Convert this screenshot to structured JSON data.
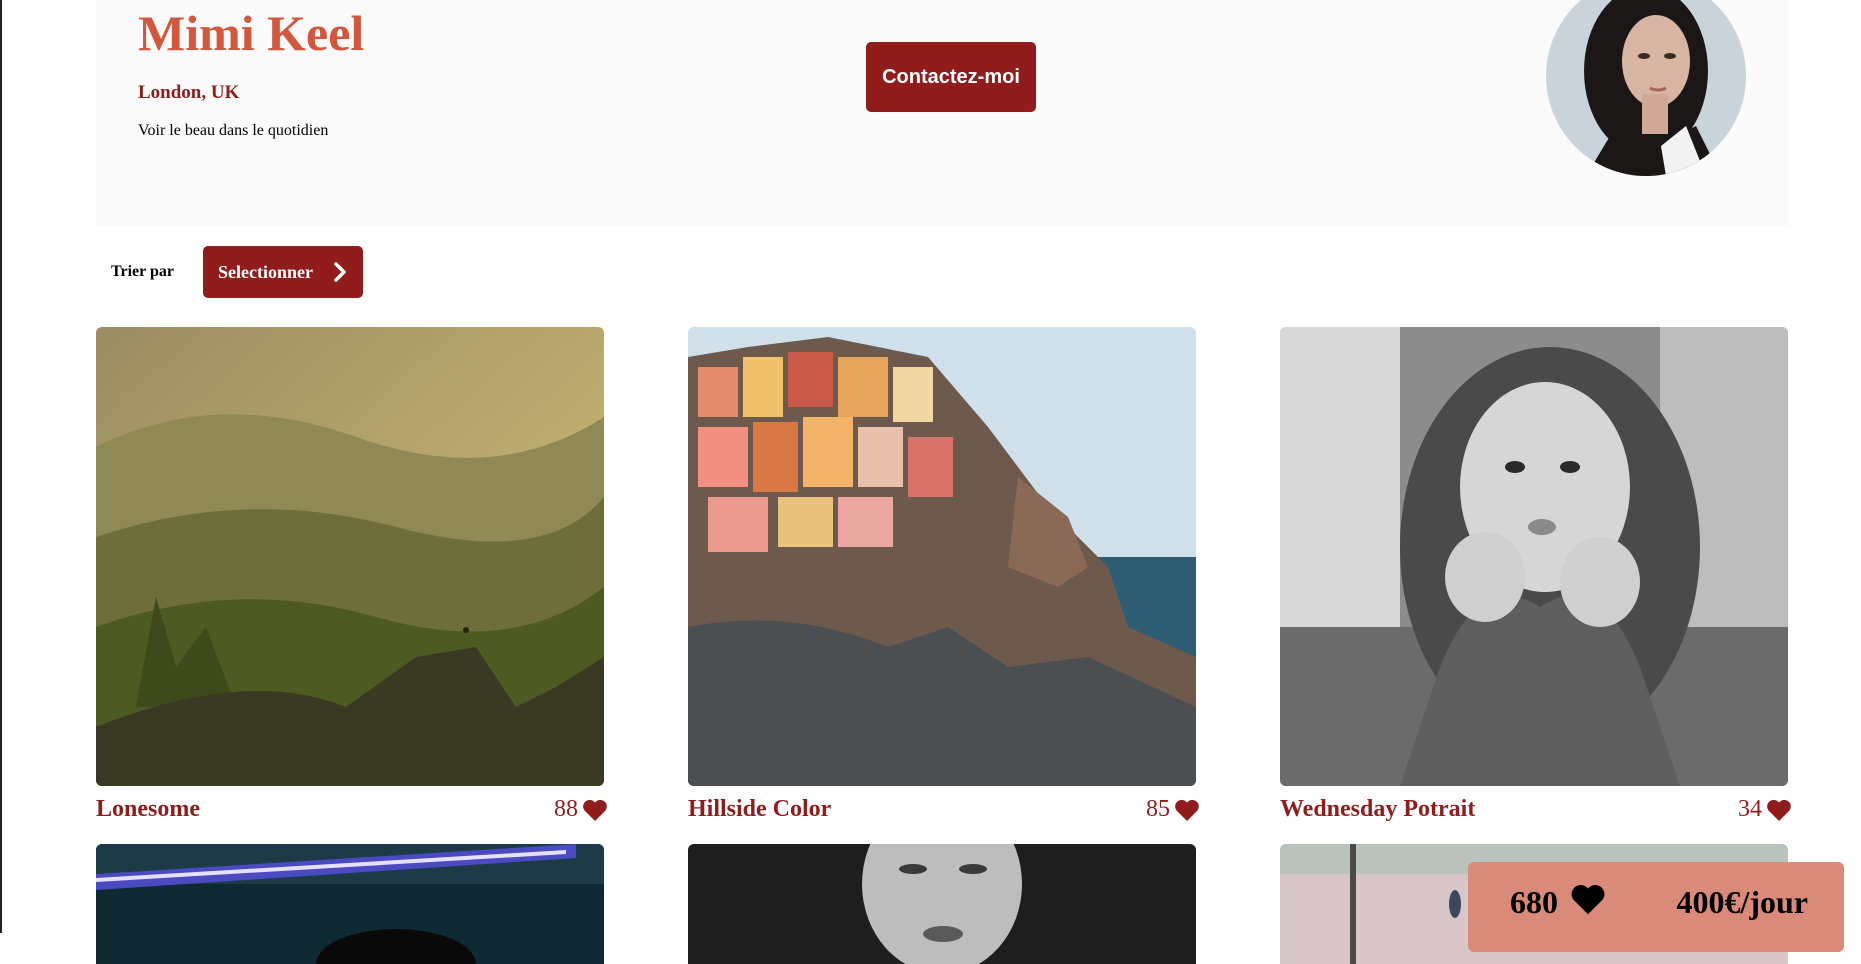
{
  "photographer": {
    "name": "Mimi Keel",
    "location": "London, UK",
    "tagline": "Voir le beau dans le quotidien",
    "contact_label": "Contactez-moi"
  },
  "sort": {
    "label": "Trier par",
    "button_label": "Selectionner"
  },
  "media": [
    {
      "title": "Lonesome",
      "likes": "88"
    },
    {
      "title": "Hillside Color",
      "likes": "85"
    },
    {
      "title": "Wednesday Potrait",
      "likes": "34"
    }
  ],
  "stats": {
    "total_likes": "680",
    "price": "400€/jour"
  },
  "colors": {
    "primary": "#901c1c",
    "accent": "#d3573c",
    "pill": "#d98a78",
    "header_bg": "#fafafa"
  },
  "icons": [
    "heart-icon",
    "chevron-right-icon"
  ]
}
